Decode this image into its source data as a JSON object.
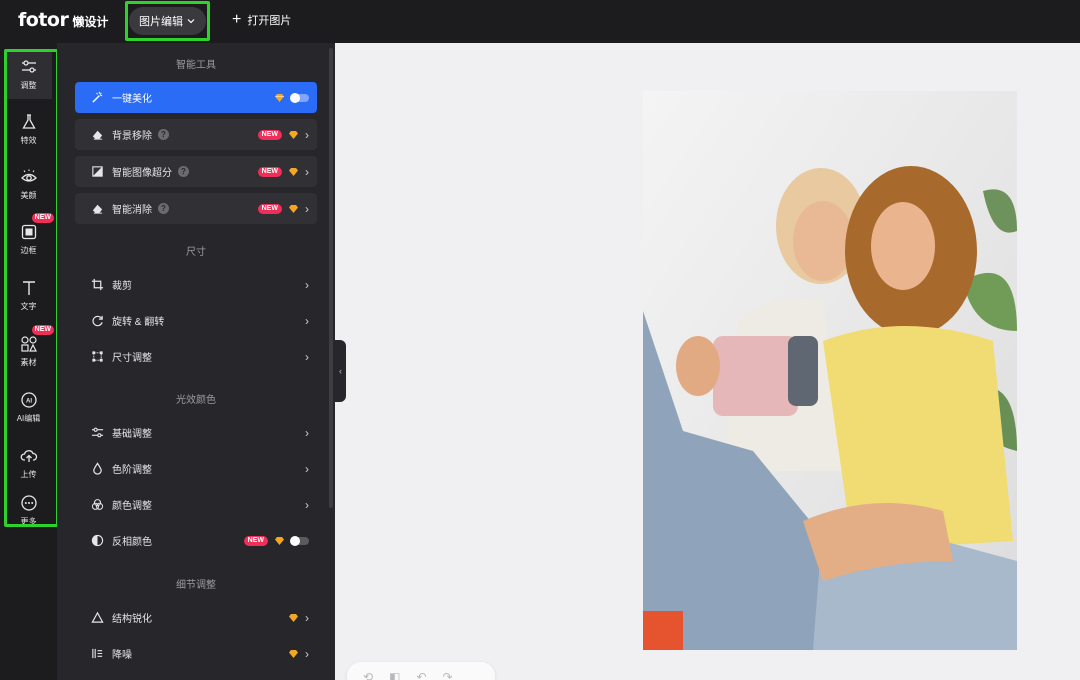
{
  "header": {
    "logo_brand": "fotor",
    "logo_sub": "懒设计",
    "mode_label": "图片编辑",
    "open_label": "打开图片"
  },
  "rail": {
    "items": [
      {
        "label": "调整",
        "icon": "sliders-icon",
        "active": true
      },
      {
        "label": "特效",
        "icon": "flask-icon"
      },
      {
        "label": "美颜",
        "icon": "eye-icon"
      },
      {
        "label": "边框",
        "icon": "frame-icon",
        "badge": "NEW"
      },
      {
        "label": "文字",
        "icon": "text-icon"
      },
      {
        "label": "素材",
        "icon": "shapes-icon",
        "badge": "NEW"
      },
      {
        "label": "AI编辑",
        "icon": "ai-icon"
      },
      {
        "label": "上传",
        "icon": "upload-cloud-icon"
      },
      {
        "label": "更多",
        "icon": "more-icon"
      }
    ]
  },
  "panel": {
    "sections": {
      "smart": "智能工具",
      "size": "尺寸",
      "light": "光效颜色",
      "detail": "细节调整"
    },
    "tools": [
      {
        "label": "一键美化",
        "icon": "magic-wand-icon",
        "premium": true,
        "toggle": true
      },
      {
        "label": "背景移除",
        "icon": "eraser-icon",
        "help": "?",
        "new": "NEW",
        "premium": true
      },
      {
        "label": "智能图像超分",
        "icon": "upscale-icon",
        "help": "?",
        "new": "NEW",
        "premium": true
      },
      {
        "label": "智能消除",
        "icon": "eraser-icon",
        "help": "?",
        "new": "NEW",
        "premium": true
      },
      {
        "label": "裁剪",
        "icon": "crop-icon"
      },
      {
        "label": "旋转 & 翻转",
        "icon": "rotate-icon"
      },
      {
        "label": "尺寸调整",
        "icon": "resize-icon"
      },
      {
        "label": "基础调整",
        "icon": "sliders-icon"
      },
      {
        "label": "色阶调整",
        "icon": "drop-icon"
      },
      {
        "label": "颜色调整",
        "icon": "color-circles-icon"
      },
      {
        "label": "反相颜色",
        "icon": "invert-icon",
        "new": "NEW",
        "premium": true,
        "toggle": true
      },
      {
        "label": "结构锐化",
        "icon": "triangle-icon",
        "premium": true
      },
      {
        "label": "降噪",
        "icon": "denoise-icon",
        "premium": true
      }
    ]
  },
  "colors": {
    "accent": "#2a6cf5",
    "highlight_outline": "#2fd22b",
    "new_badge": "#ef2f58",
    "premium": "#f5a623"
  }
}
